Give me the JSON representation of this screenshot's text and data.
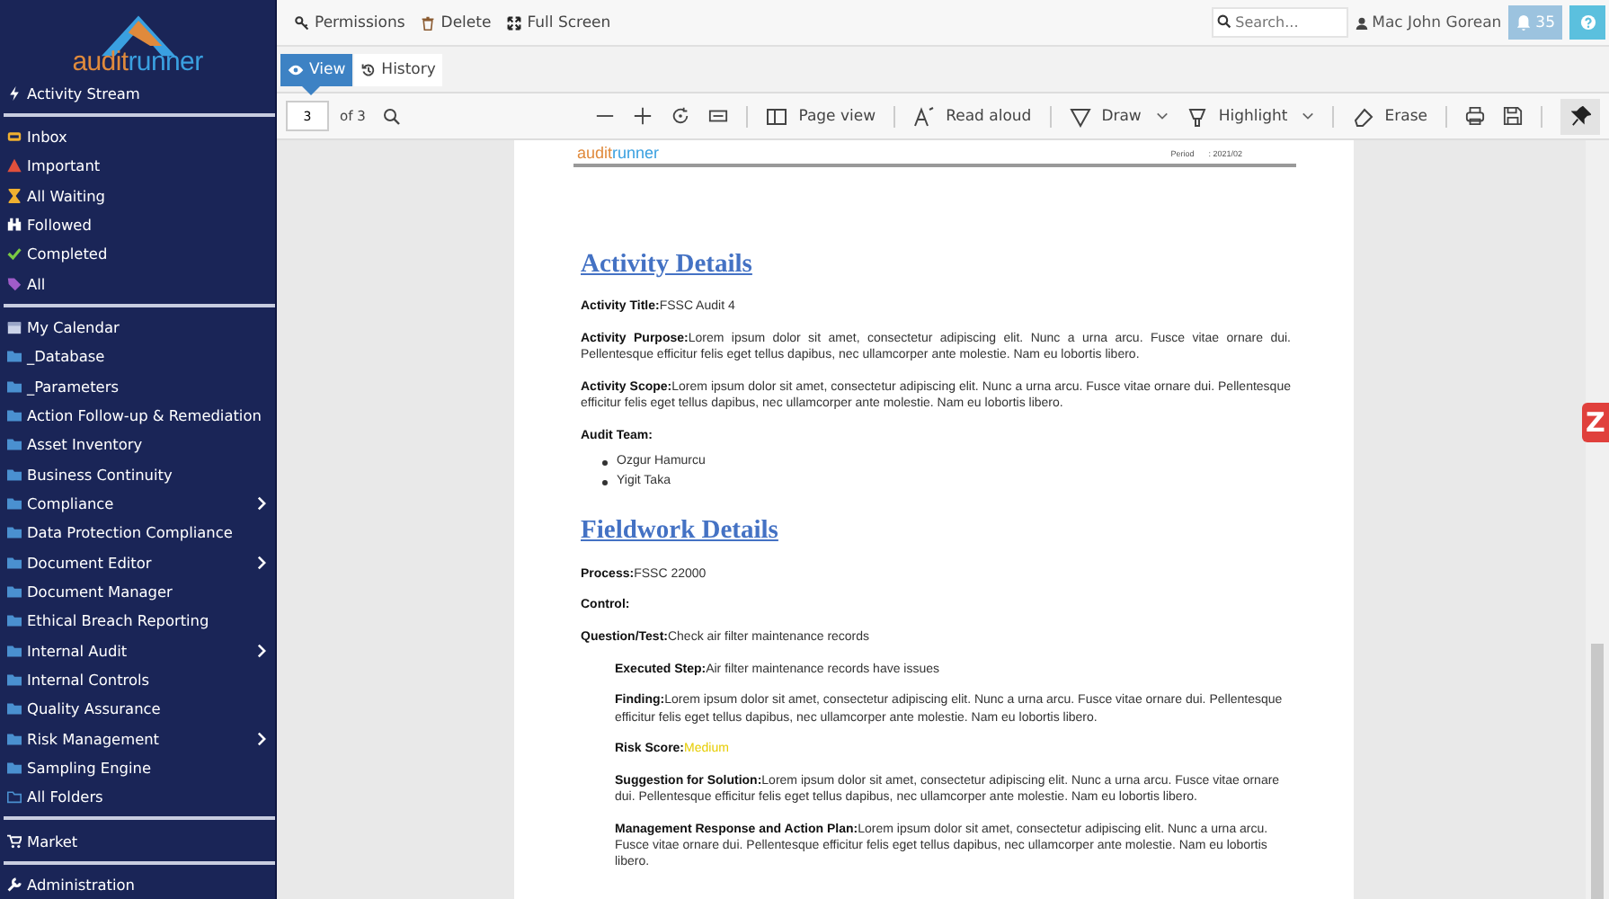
{
  "logo": {
    "text_a": "audit",
    "text_b": "runner"
  },
  "sidebar": {
    "sections": [
      [
        {
          "label": "Activity Stream",
          "submenu": false
        }
      ],
      [
        {
          "label": "Inbox",
          "submenu": false
        },
        {
          "label": "Important",
          "submenu": false
        },
        {
          "label": "All Waiting",
          "submenu": false
        },
        {
          "label": "Followed",
          "submenu": false
        },
        {
          "label": "Completed",
          "submenu": false
        },
        {
          "label": "All",
          "submenu": false
        }
      ],
      [
        {
          "label": "My Calendar",
          "submenu": false
        },
        {
          "label": "_Database",
          "submenu": false
        },
        {
          "label": "_Parameters",
          "submenu": false
        },
        {
          "label": "Action Follow-up & Remediation",
          "submenu": false
        },
        {
          "label": "Asset Inventory",
          "submenu": false
        },
        {
          "label": "Business Continuity",
          "submenu": false
        },
        {
          "label": "Compliance",
          "submenu": true
        },
        {
          "label": "Data Protection Compliance",
          "submenu": false
        },
        {
          "label": "Document Editor",
          "submenu": true
        },
        {
          "label": "Document Manager",
          "submenu": false
        },
        {
          "label": "Ethical Breach Reporting",
          "submenu": false
        },
        {
          "label": "Internal Audit",
          "submenu": true
        },
        {
          "label": "Internal Controls",
          "submenu": false
        },
        {
          "label": "Quality Assurance",
          "submenu": false
        },
        {
          "label": "Risk Management",
          "submenu": true
        },
        {
          "label": "Sampling Engine",
          "submenu": false
        },
        {
          "label": "All Folders",
          "submenu": false
        }
      ],
      [
        {
          "label": "Market",
          "submenu": false
        }
      ],
      [
        {
          "label": "Administration",
          "submenu": false
        }
      ]
    ]
  },
  "topbar": {
    "actions": [
      "Permissions",
      "Delete",
      "Full Screen"
    ],
    "search": {
      "placeholder": "Search..."
    },
    "user": "Mac John Gorean",
    "notifications": "35"
  },
  "tabs": [
    {
      "label": "View",
      "selected": true
    },
    {
      "label": "History",
      "selected": false
    }
  ],
  "pdf_toolbar": {
    "page": "3",
    "of": "of 3",
    "tools": [
      {
        "label": "Page view",
        "dropdown": false
      },
      {
        "label": "Read aloud",
        "dropdown": false
      },
      {
        "label": "Draw",
        "dropdown": true
      },
      {
        "label": "Highlight",
        "dropdown": true
      },
      {
        "label": "Erase",
        "dropdown": false
      }
    ]
  },
  "document": {
    "header": {
      "logo_a": "audit",
      "logo_b": "runner",
      "period_label": "Period",
      "period_value": ": 2021/02"
    },
    "sections": [
      {
        "heading": "Activity Details",
        "fields": [
          {
            "kind": "field",
            "label": "Activity Title:",
            "value": "FSSC Audit 4",
            "indent": false
          },
          {
            "kind": "field",
            "label": "Activity Purpose:",
            "value": "Lorem ipsum dolor sit amet, consectetur adipiscing elit. Nunc a urna arcu. Fusce vitae ornare dui. Pellentesque efficitur felis eget tellus dapibus, nec ullamcorper ante molestie. Nam eu lobortis libero.",
            "indent": false
          },
          {
            "kind": "field",
            "label": "Activity Scope:",
            "value": "Lorem ipsum dolor sit amet, consectetur adipiscing elit. Nunc a urna arcu. Fusce vitae ornare dui. Pellentesque efficitur felis eget tellus dapibus, nec ullamcorper ante molestie. Nam eu lobortis libero.",
            "indent": false
          },
          {
            "kind": "list",
            "label": "Audit Team:",
            "items": [
              "Ozgur Hamurcu",
              "Yigit Taka"
            ]
          }
        ]
      },
      {
        "heading": "Fieldwork Details",
        "fields": [
          {
            "kind": "field",
            "label": "Process:",
            "value": "FSSC 22000",
            "indent": false
          },
          {
            "kind": "field",
            "label": "Control:",
            "indent": false
          },
          {
            "kind": "field",
            "label": "Question/Test:",
            "value": "Check air filter maintenance records",
            "indent": false
          },
          {
            "kind": "field",
            "label": "Executed Step:",
            "value": "Air filter maintenance records have issues",
            "indent": true
          },
          {
            "kind": "field",
            "label": "Finding:",
            "value": "Lorem ipsum dolor sit amet, consectetur adipiscing elit. Nunc a urna arcu. Fusce vitae ornare dui. Pellentesque efficitur felis eget tellus dapibus, nec ullamcorper ante molestie. Nam eu lobortis libero.",
            "indent": true
          },
          {
            "kind": "field",
            "label": "Risk Score:",
            "value": "Medium",
            "indent": true,
            "color": "#e6cc00"
          },
          {
            "kind": "field",
            "label": "Suggestion for Solution:",
            "value": "Lorem ipsum dolor sit amet, consectetur adipiscing elit. Nunc a urna arcu. Fusce vitae ornare dui. Pellentesque efficitur felis eget tellus dapibus, nec ullamcorper ante molestie. Nam eu lobortis libero.",
            "indent": true
          },
          {
            "kind": "field",
            "label": "Management Response and Action Plan:",
            "value": "Lorem ipsum dolor sit amet, consectetur adipiscing elit. Nunc a urna arcu. Fusce vitae ornare dui. Pellentesque efficitur felis eget tellus dapibus, nec ullamcorper ante molestie. Nam eu lobortis libero.",
            "indent": true
          }
        ]
      }
    ]
  },
  "side_widget": "Z"
}
